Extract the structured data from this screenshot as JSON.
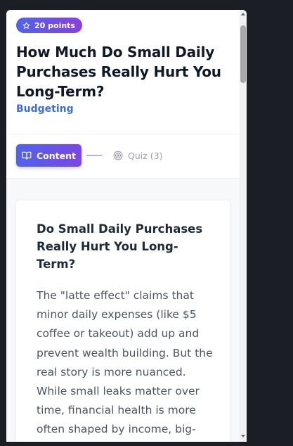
{
  "badge": {
    "icon": "star-icon",
    "label": "20 points"
  },
  "lesson": {
    "title": "How Much Do Small Daily Purchases Really Hurt You Long-Term?",
    "category": "Budgeting"
  },
  "tabs": {
    "content_label": "Content",
    "content_icon": "book-icon",
    "quiz_label": "Quiz (3)",
    "quiz_icon": "target-icon"
  },
  "card": {
    "heading": "Do Small Daily Purchases Really Hurt You Long-Term?",
    "body": "The \"latte effect\" claims that minor daily expenses (like $5 coffee or takeout) add up and prevent wealth building. But the real story is more nuanced. While small leaks matter over time, financial health is more often shaped by income, big-"
  },
  "colors": {
    "accent_start": "#4f63ea",
    "accent_end": "#8b3fe0",
    "category": "#3b6fe6",
    "title": "#101828",
    "muted": "#9aa0aa"
  }
}
